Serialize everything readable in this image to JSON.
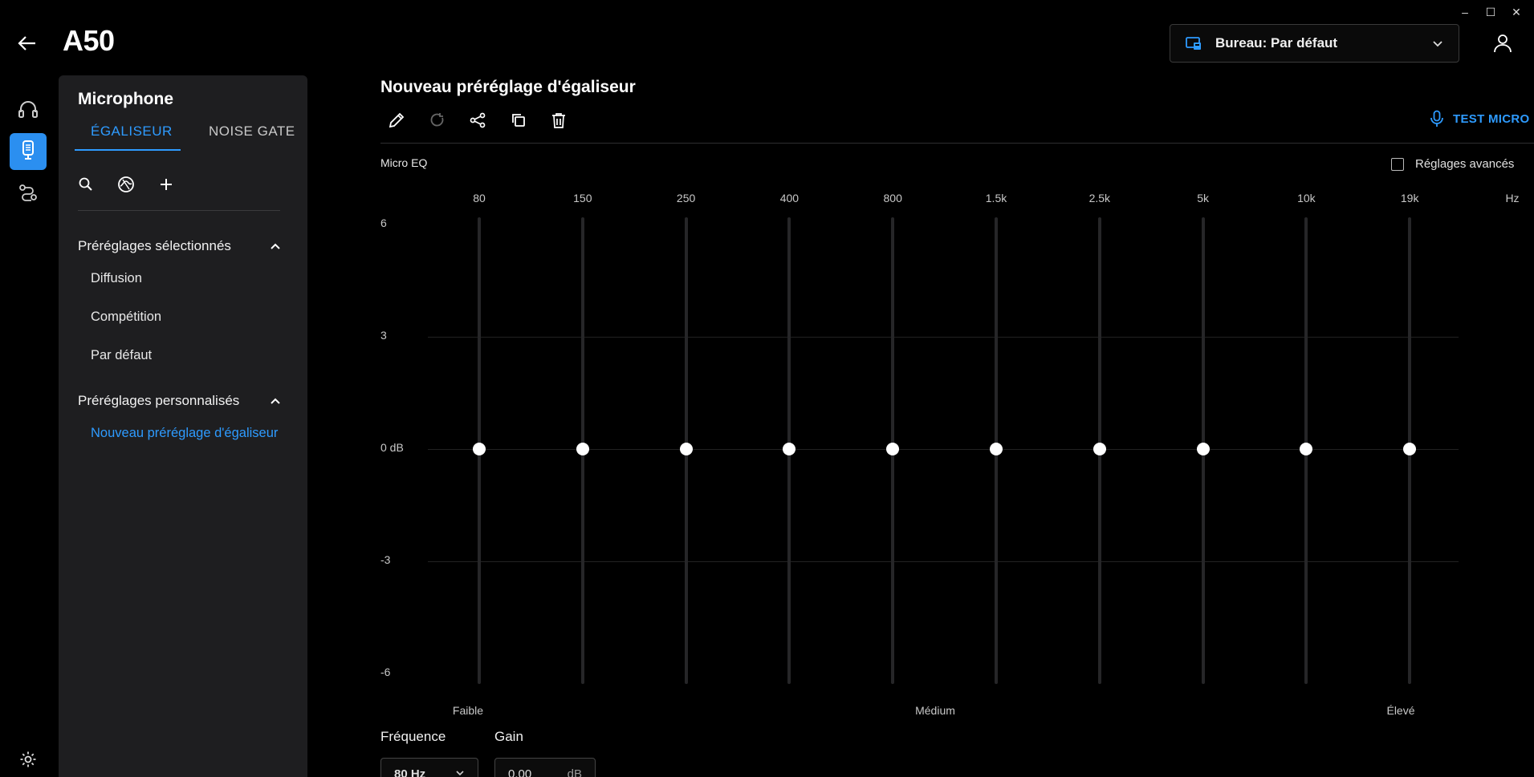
{
  "app": {
    "title": "A50"
  },
  "profile": {
    "label": "Bureau: Par défaut"
  },
  "panel": {
    "title": "Microphone",
    "tabs": [
      {
        "label": "ÉGALISEUR",
        "active": true
      },
      {
        "label": "NOISE GATE",
        "active": false
      }
    ],
    "groups": [
      {
        "label": "Préréglages sélectionnés",
        "items": [
          "Diffusion",
          "Compétition",
          "Par défaut"
        ]
      },
      {
        "label": "Préréglages personnalisés",
        "items": [
          "Nouveau préréglage d'égaliseur"
        ]
      }
    ]
  },
  "main": {
    "title": "Nouveau préréglage d'égaliseur",
    "test_micro": "TEST MICRO",
    "eq_label": "Micro EQ",
    "advanced": {
      "label": "Réglages avancés",
      "checked": false
    }
  },
  "eq": {
    "unit": "Hz",
    "bands": [
      "80",
      "150",
      "250",
      "400",
      "800",
      "1.5k",
      "2.5k",
      "5k",
      "10k",
      "19k"
    ],
    "gains_db": [
      0,
      0,
      0,
      0,
      0,
      0,
      0,
      0,
      0,
      0
    ],
    "db_labels": [
      "6",
      "3",
      "0 dB",
      "-3",
      "-6"
    ],
    "ranges": [
      "Faible",
      "Médium",
      "Élevé"
    ]
  },
  "fields": {
    "frequency": {
      "label": "Fréquence",
      "value": "80 Hz"
    },
    "gain": {
      "label": "Gain",
      "value": "0.00",
      "unit": "dB"
    }
  },
  "colors": {
    "accent": "#2e9bff",
    "panel": "#1e1e20",
    "background": "#000000"
  }
}
